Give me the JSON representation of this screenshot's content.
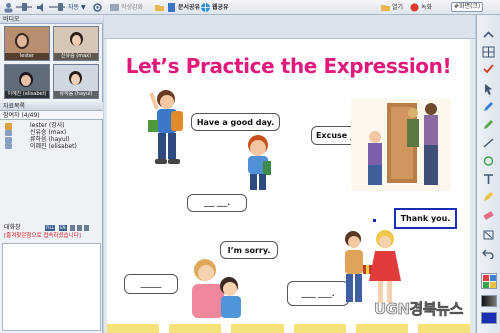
{
  "topbar": {
    "more_label": "자동 ▼",
    "teacher_label": "학생감화",
    "share_doc": "문서공유",
    "share_web": "웹공유",
    "open": "열기",
    "record": "녹화",
    "mode": "#화면(크)"
  },
  "sidebar": {
    "video_title": "비디오",
    "videos": [
      {
        "name": "lester"
      },
      {
        "name": "신유승 (max)"
      },
      {
        "name": "이혜진 (elisabet)"
      },
      {
        "name": "류하음 (hayul)"
      }
    ],
    "tabs": "자료목록",
    "participants_title": "참여자 (4/49)",
    "participants": [
      "lester (강사)",
      "신유승 (max)",
      "류하음 (hayul)",
      "이혜진 (elisabet)"
    ],
    "chat_title": "대화창",
    "chat_badges": [
      "FILL",
      "EN"
    ],
    "chat_message": "[즐겨찾은항으로 접속하셨습니다]"
  },
  "slide": {
    "title": "Let’s Practice the Expression!",
    "bubble1": "Have a good day.",
    "bubble2": "Excuse ___.",
    "bubble3": "I’m sorry.",
    "bubble4": "Thank you.",
    "blank": "___ ___.",
    "blank3": "______",
    "blank4": "____ ____."
  },
  "watermark": "UGN경북뉴스",
  "colors": {
    "title": "#e0197a",
    "highlight": "#1a2db5",
    "footer": "#f6e27a"
  }
}
